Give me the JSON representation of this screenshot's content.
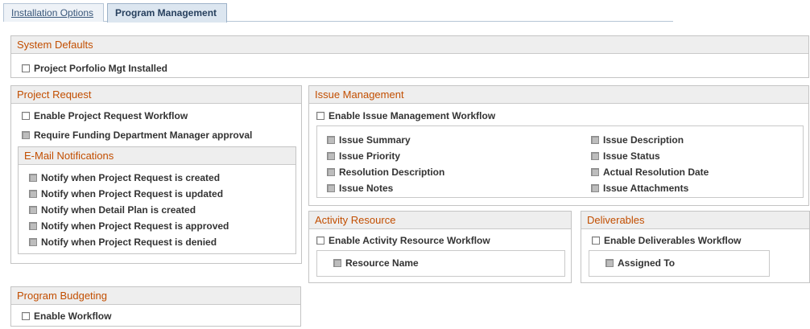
{
  "tabs": [
    {
      "label": "Installation Options",
      "active": false
    },
    {
      "label": "Program Management",
      "active": true
    }
  ],
  "system_defaults": {
    "title": "System Defaults",
    "portfolio_installed": {
      "label": "Project Porfolio Mgt Installed",
      "checked": false,
      "enabled": true
    }
  },
  "project_request": {
    "title": "Project Request",
    "enable_workflow": {
      "label": "Enable Project Request Workflow",
      "checked": false,
      "enabled": true
    },
    "require_funding": {
      "label": "Require Funding Department Manager approval",
      "checked": false,
      "enabled": false
    },
    "email": {
      "title": "E-Mail Notifications",
      "items": [
        {
          "label": "Notify when Project Request is created",
          "checked": false,
          "enabled": false
        },
        {
          "label": "Notify when Project Request is updated",
          "checked": false,
          "enabled": false
        },
        {
          "label": "Notify when Detail Plan is created",
          "checked": false,
          "enabled": false
        },
        {
          "label": "Notify when Project Request is approved",
          "checked": false,
          "enabled": false
        },
        {
          "label": "Notify when Project Request is denied",
          "checked": false,
          "enabled": false
        }
      ]
    }
  },
  "issue_management": {
    "title": "Issue Management",
    "enable_workflow": {
      "label": "Enable Issue Management Workflow",
      "checked": false,
      "enabled": true
    },
    "left_items": [
      {
        "label": "Issue Summary",
        "checked": false,
        "enabled": false
      },
      {
        "label": "Issue Priority",
        "checked": false,
        "enabled": false
      },
      {
        "label": "Resolution Description",
        "checked": false,
        "enabled": false
      },
      {
        "label": "Issue Notes",
        "checked": false,
        "enabled": false
      }
    ],
    "right_items": [
      {
        "label": "Issue Description",
        "checked": false,
        "enabled": false
      },
      {
        "label": "Issue Status",
        "checked": false,
        "enabled": false
      },
      {
        "label": "Actual Resolution Date",
        "checked": false,
        "enabled": false
      },
      {
        "label": "Issue Attachments",
        "checked": false,
        "enabled": false
      }
    ]
  },
  "activity_resource": {
    "title": "Activity Resource",
    "enable_workflow": {
      "label": "Enable Activity Resource Workflow",
      "checked": false,
      "enabled": true
    },
    "resource_name": {
      "label": "Resource Name",
      "checked": false,
      "enabled": false
    }
  },
  "deliverables": {
    "title": "Deliverables",
    "enable_workflow": {
      "label": "Enable Deliverables Workflow",
      "checked": false,
      "enabled": true
    },
    "assigned_to": {
      "label": "Assigned To",
      "checked": false,
      "enabled": false
    }
  },
  "program_budgeting": {
    "title": "Program Budgeting",
    "enable_workflow": {
      "label": "Enable Workflow",
      "checked": false,
      "enabled": true
    }
  },
  "colors": {
    "header_text": "#c24e00",
    "header_bg": "#eeeeee",
    "border": "#c4c4c4",
    "tab_active_bg": "#dce6f0"
  }
}
